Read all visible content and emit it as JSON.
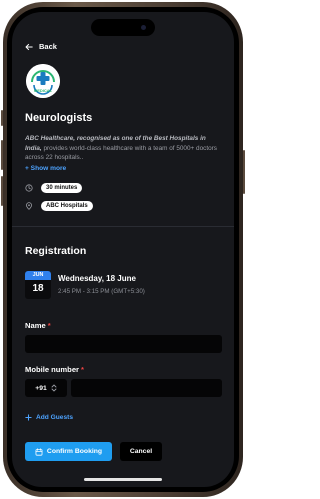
{
  "nav": {
    "back_label": "Back"
  },
  "clinic": {
    "logo_text": "MEDICAL"
  },
  "doctor": {
    "title": "Neurologists",
    "description_bold": "ABC Healthcare, recognised as one of the Best Hospitals in India,",
    "description_rest": " provides world-class healthcare with a team of 5000+ doctors across 22 hospitals..",
    "show_more_label": "+ Show more",
    "duration": "30 minutes",
    "location": "ABC Hospitals"
  },
  "registration": {
    "title": "Registration",
    "date": {
      "month": "JUN",
      "day": "18",
      "full": "Wednesday, 18 June",
      "time": "2:45 PM - 3:15 PM (GMT+5:30)"
    },
    "name_label": "Name",
    "name_value": "",
    "mobile_label": "Mobile number",
    "country_code": "+91",
    "mobile_value": "",
    "required_mark": "*",
    "add_guests_label": "Add Guests",
    "confirm_label": "Confirm Booking",
    "cancel_label": "Cancel"
  },
  "colors": {
    "accent": "#1f9df0",
    "link": "#4da3ff",
    "required": "#ef4444",
    "screen_bg": "#17181c"
  }
}
